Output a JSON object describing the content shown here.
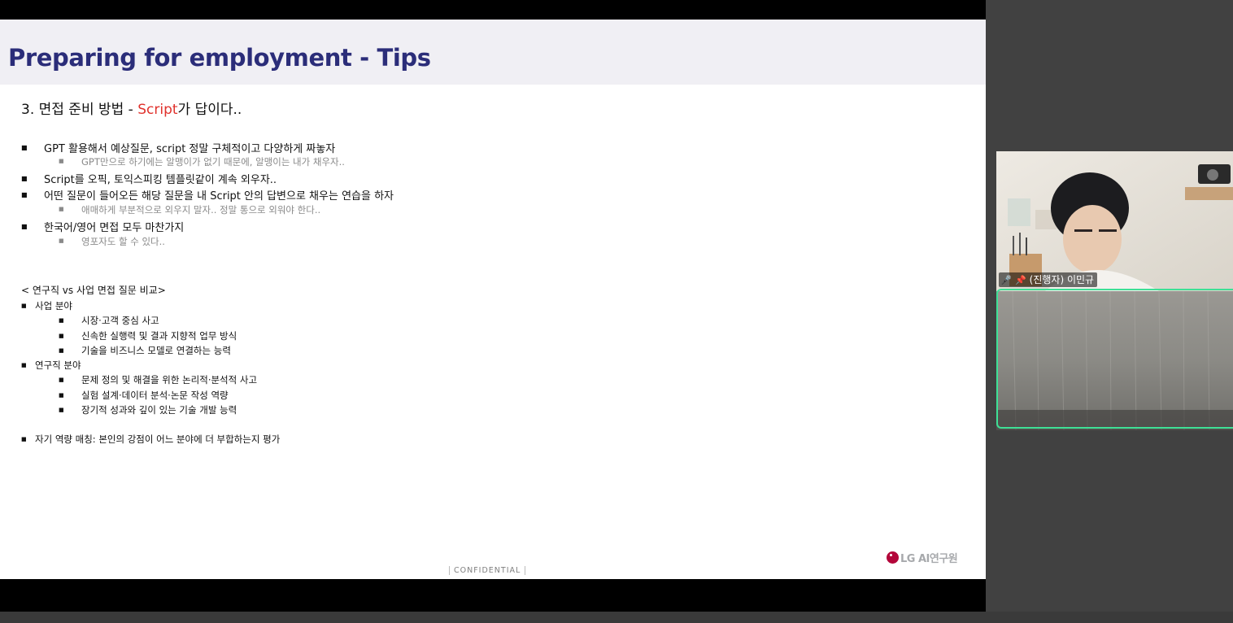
{
  "slide": {
    "title": "Preparing for employment - Tips",
    "heading_prefix": "3. 면접 준비 방법 - ",
    "heading_accent": "Script",
    "heading_suffix": "가 답이다..",
    "tips": [
      "GPT 활용해서 예상질문, script 정말 구체적이고 다양하게 짜놓자",
      "GPT만으로 하기에는 알맹이가 없기 때문에, 알맹이는 내가 채우자..",
      "Script를 오픽, 토익스피킹 템플릿같이 계속 외우자..",
      "어떤 질문이 들어오든 해당 질문을 내 Script 안의 답변으로 채우는 연습을 하자",
      "애매하게 부분적으로 외우지 말자.. 정말 통으로 외워야 한다..",
      "한국어/영어 면접 모두 마찬가지",
      "영포자도 할 수 있다.."
    ],
    "compare_title": "< 연구직 vs 사업 면접 질문 비교>",
    "business_label": "사업 분야",
    "business_items": [
      "시장·고객 중심 사고",
      "신속한 실행력 및 결과 지향적 업무 방식",
      "기술을 비즈니스 모델로 연결하는 능력"
    ],
    "research_label": "연구직 분야",
    "research_items": [
      "문제 정의 및 해결을 위한 논리적·분석적 사고",
      "실험 설계·데이터 분석·논문 작성 역량",
      "장기적 성과와 깊이 있는 기술 개발 능력"
    ],
    "self_match": "자기 역량 매칭: 본인의 강점이 어느 분야에 더 부합하는지 평가",
    "logo_text": "LG AI연구원",
    "confidential": "CONFIDENTIAL",
    "bullet_glyph": "■"
  },
  "participant": {
    "name": "(진행자) 이민규",
    "muted_icon": "mic-muted-icon",
    "pin_icon": "pin-icon"
  },
  "colors": {
    "title": "#2b2d79",
    "accent": "#e0312c",
    "active_speaker_border": "#3ee096",
    "logo_red": "#b3063a"
  }
}
